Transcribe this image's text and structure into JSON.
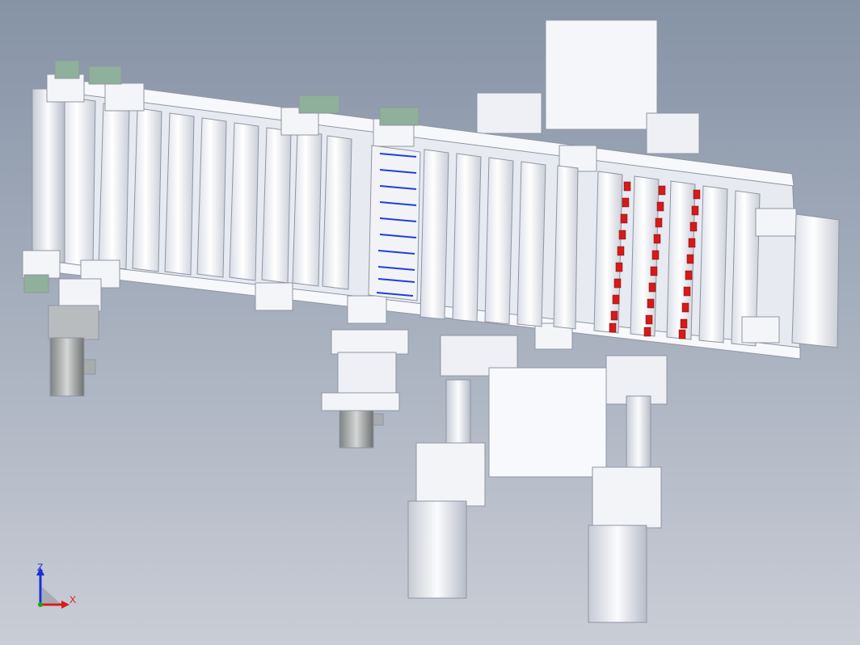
{
  "viewport": {
    "background_top": "#8693a6",
    "background_bottom": "#c9cdd6"
  },
  "model": {
    "part_color": "#f2f4f8",
    "part_edge": "#8f96a3",
    "accent_red": "#d41a1a",
    "accent_blue": "#1f3fd6",
    "accent_green": "#8fb09a",
    "motor_color": "#9a9c9c"
  },
  "triad": {
    "z_label": "Z",
    "x_label": "X",
    "z_color": "#1a2fd8",
    "x_color": "#d81a1a",
    "origin_color": "#1aa31a"
  }
}
